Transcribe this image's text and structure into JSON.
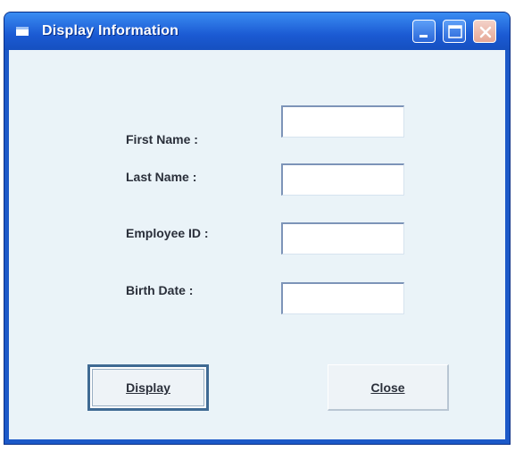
{
  "window": {
    "title": "Display Information"
  },
  "titlebar_buttons": {
    "minimize": "minimize-icon",
    "maximize": "maximize-icon",
    "close": "close-icon"
  },
  "form": {
    "first_name_label": "First Name :",
    "last_name_label": "Last Name :",
    "employee_id_label": "Employee ID :",
    "birth_date_label": "Birth Date :",
    "first_name_value": "",
    "last_name_value": "",
    "employee_id_value": "",
    "birth_date_value": ""
  },
  "buttons": {
    "display_label": "Display",
    "close_label": "Close"
  },
  "colors": {
    "titlebar": "#1b5ad3",
    "client_background": "#eaf3f8"
  }
}
